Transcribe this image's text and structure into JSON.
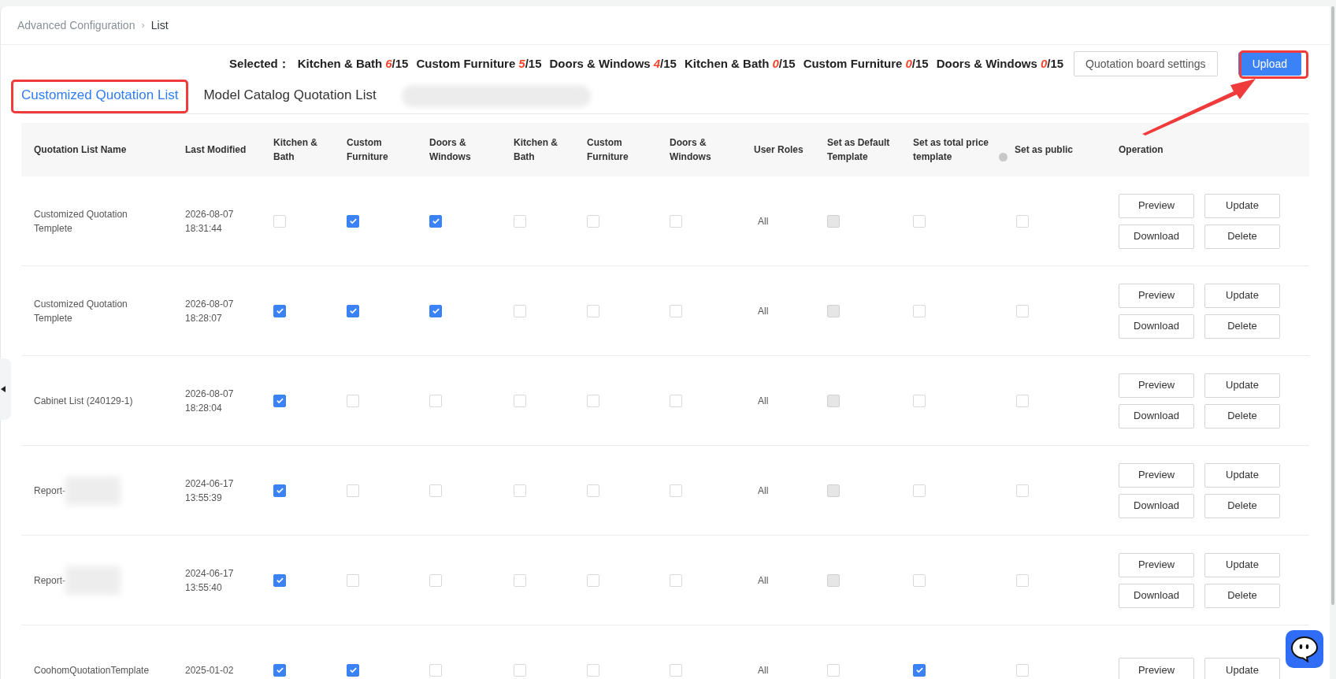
{
  "breadcrumb": {
    "separator": "›",
    "items": [
      {
        "label": "Advanced Configuration",
        "current": false
      },
      {
        "label": "List",
        "current": true
      }
    ]
  },
  "selected": {
    "label": "Selected：",
    "counts": [
      {
        "category": "Kitchen & Bath",
        "count": "6",
        "total": "/15"
      },
      {
        "category": "Custom Furniture",
        "count": "5",
        "total": "/15"
      },
      {
        "category": "Doors & Windows",
        "count": "4",
        "total": "/15"
      },
      {
        "category": "Kitchen & Bath",
        "count": "0",
        "total": "/15"
      },
      {
        "category": "Custom Furniture",
        "count": "0",
        "total": "/15"
      },
      {
        "category": "Doors & Windows",
        "count": "0",
        "total": "/15"
      }
    ]
  },
  "toolbar_buttons": [
    {
      "label": "Quotation board settings",
      "kind": "secondary"
    },
    {
      "label": "Upload",
      "kind": "primary"
    }
  ],
  "tabs": [
    {
      "label": "Customized Quotation List",
      "selected": true
    },
    {
      "label": "Model Catalog Quotation List",
      "selected": false
    }
  ],
  "table": {
    "columns": [
      {
        "label": "Quotation List Name",
        "info": false
      },
      {
        "label": "Last Modified",
        "info": false
      },
      {
        "label": "Kitchen & Bath",
        "info": false
      },
      {
        "label": "Custom Furniture",
        "info": false
      },
      {
        "label": "Doors & Windows",
        "info": false
      },
      {
        "label": "Kitchen & Bath",
        "info": false
      },
      {
        "label": "Custom Furniture",
        "info": false
      },
      {
        "label": "Doors & Windows",
        "info": false
      },
      {
        "label": "User Roles",
        "info": false
      },
      {
        "label": "Set as Default Template",
        "info": false
      },
      {
        "label": "Set as total price template",
        "info": true
      },
      {
        "label": "Set as public",
        "info": false
      },
      {
        "label": "Operation",
        "info": false
      }
    ],
    "rows": [
      {
        "name": "Customized Quotation Templete",
        "name_redacted": false,
        "date": "2026-08-07",
        "time": "18:31:44",
        "checks": [
          false,
          true,
          true,
          false,
          false,
          false
        ],
        "roles": "All",
        "default": {
          "checked": false,
          "disabled": true
        },
        "total_price": false,
        "public": false,
        "actions": [
          "Preview",
          "Update",
          "Download",
          "Delete"
        ]
      },
      {
        "name": "Customized Quotation Templete",
        "name_redacted": false,
        "date": "2026-08-07",
        "time": "18:28:07",
        "checks": [
          true,
          true,
          true,
          false,
          false,
          false
        ],
        "roles": "All",
        "default": {
          "checked": false,
          "disabled": true
        },
        "total_price": false,
        "public": false,
        "actions": [
          "Preview",
          "Update",
          "Download",
          "Delete"
        ]
      },
      {
        "name": "Cabinet List (240129-1)",
        "name_redacted": false,
        "date": "2026-08-07",
        "time": "18:28:04",
        "checks": [
          true,
          false,
          false,
          false,
          false,
          false
        ],
        "roles": "All",
        "default": {
          "checked": false,
          "disabled": true
        },
        "total_price": false,
        "public": false,
        "actions": [
          "Preview",
          "Update",
          "Download",
          "Delete"
        ]
      },
      {
        "name": "Report-",
        "name_redacted": true,
        "date": "2024-06-17",
        "time": "13:55:39",
        "checks": [
          true,
          false,
          false,
          false,
          false,
          false
        ],
        "roles": "All",
        "default": {
          "checked": false,
          "disabled": true
        },
        "total_price": false,
        "public": false,
        "actions": [
          "Preview",
          "Update",
          "Download",
          "Delete"
        ]
      },
      {
        "name": "Report-",
        "name_redacted": true,
        "date": "2024-06-17",
        "time": "13:55:40",
        "checks": [
          true,
          false,
          false,
          false,
          false,
          false
        ],
        "roles": "All",
        "default": {
          "checked": false,
          "disabled": true
        },
        "total_price": false,
        "public": false,
        "actions": [
          "Preview",
          "Update",
          "Download",
          "Delete"
        ]
      },
      {
        "name": "CoohomQuotationTemplate",
        "name_redacted": false,
        "date": "2025-01-02",
        "checks": [
          true,
          true,
          false,
          false,
          false,
          false
        ],
        "roles": "All",
        "default": {
          "checked": false,
          "disabled": false
        },
        "total_price": true,
        "public": false,
        "actions": [
          "Preview",
          "Update"
        ]
      }
    ]
  }
}
